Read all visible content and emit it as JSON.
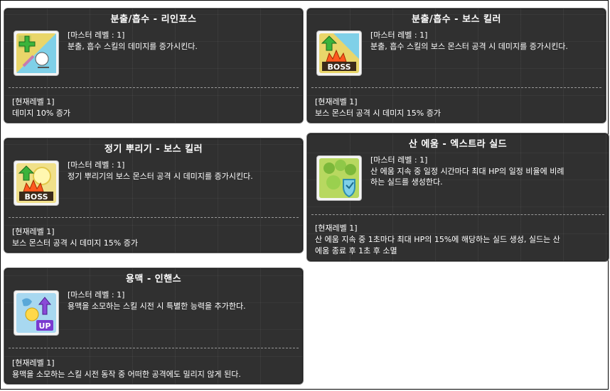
{
  "tooltips": [
    {
      "title": "분출/흡수 - 리인포스",
      "master": "[마스터 레벨 : 1]",
      "desc": [
        "분출, 흡수 스킬의 데미지를 증가시킨다."
      ],
      "current": "[현재레벨 1]",
      "effect": [
        "데미지 10% 증가"
      ],
      "icon": "reinforce-skill-icon"
    },
    {
      "title": "분출/흡수 - 보스 킬러",
      "master": "[마스터 레벨 : 1]",
      "desc": [
        "분출, 흡수 스킬의 보스 몬스터 공격 시 데미지를 증가시킨다."
      ],
      "current": "[현재레벨 1]",
      "effect": [
        "보스 몬스터 공격 시 데미지 15% 증가"
      ],
      "icon": "boss-killer-skill-icon"
    },
    {
      "title": "정기 뿌리기 - 보스 킬러",
      "master": "[마스터 레벨 : 1]",
      "desc": [
        "정기 뿌리기의 보스 몬스터 공격 시 데미지를 증가시킨다."
      ],
      "current": "[현재레벨 1]",
      "effect": [
        "보스 몬스터 공격 시 데미지 15% 증가"
      ],
      "icon": "boss-killer-skill-icon"
    },
    {
      "title": "산 에움 - 엑스트라 실드",
      "master": "[마스터 레벨 : 1]",
      "desc": [
        "산 에움 지속 중 일정 시간마다 최대 HP의 일정 비율에 비례",
        "하는 실드를 생성한다."
      ],
      "current": "[현재레벨 1]",
      "effect": [
        "산 에움 지속 중 1초마다 최대 HP의 15%에 해당하는 실드 생성, 실드는 산",
        "에움 종료 후 1초 후 소멸"
      ],
      "icon": "extra-shield-skill-icon"
    },
    {
      "title": "용맥 - 인핸스",
      "master": "[마스터 레벨 : 1]",
      "desc": [
        "용맥을 소모하는 스킬 시전 시 특별한 능력을 추가한다."
      ],
      "current": "[현재레벨 1]",
      "effect": [
        "용맥을 소모하는 스킬 시전 동작 중 어떠한 공격에도 밀리지 않게 된다."
      ],
      "icon": "enhance-skill-icon",
      "icon_label": "UP"
    }
  ],
  "icon_labels": {
    "boss": "BOSS",
    "up": "UP"
  },
  "colors": {
    "tooltip_bg": "#202020",
    "border": "#6f6f6f",
    "text": "#ffffff"
  }
}
